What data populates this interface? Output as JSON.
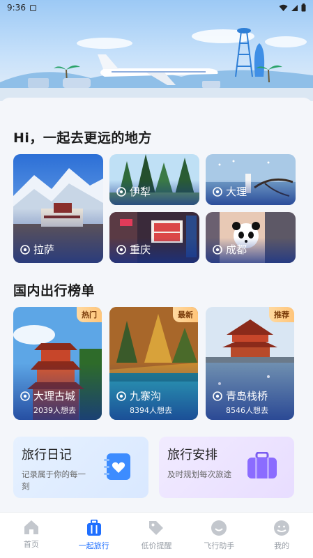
{
  "status_bar": {
    "time": "9:36"
  },
  "hero": {
    "alt": "airport illustration"
  },
  "section1": {
    "title": "Hi，一起去更远的地方",
    "cards": [
      {
        "name": "拉萨"
      },
      {
        "name": "伊犁"
      },
      {
        "name": "大理"
      },
      {
        "name": "重庆"
      },
      {
        "name": "成都"
      }
    ]
  },
  "section2": {
    "title": "国内出行榜单",
    "cards": [
      {
        "name": "大理古城",
        "count": "2039人想去",
        "tag": "热门"
      },
      {
        "name": "九寨沟",
        "count": "8394人想去",
        "tag": "最新"
      },
      {
        "name": "青岛栈桥",
        "count": "8546人想去",
        "tag": "推荐"
      }
    ]
  },
  "features": [
    {
      "title": "旅行日记",
      "desc": "记录属于你的每一刻"
    },
    {
      "title": "旅行安排",
      "desc": "及时规划每次旅途"
    }
  ],
  "tabbar": [
    {
      "label": "首页",
      "icon": "home-icon"
    },
    {
      "label": "一起旅行",
      "icon": "luggage-icon"
    },
    {
      "label": "低价提醒",
      "icon": "tag-icon"
    },
    {
      "label": "飞行助手",
      "icon": "smile-icon"
    },
    {
      "label": "我的",
      "icon": "user-icon"
    }
  ],
  "colors": {
    "accent": "#1f6fff",
    "tag_bg": "#ffc57a",
    "diary_bg": "#e3efff",
    "plan_bg": "#efe8ff"
  }
}
